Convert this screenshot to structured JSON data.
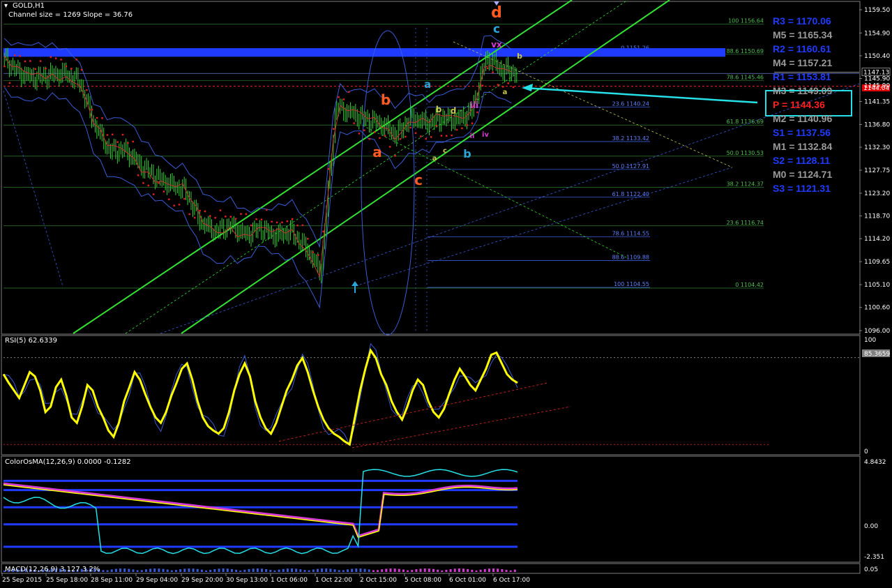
{
  "window": {
    "title": "GOLD,H1",
    "channel_info": "Channel size = 1269 Slope = 36.76"
  },
  "chart_data": [
    {
      "type": "line",
      "name": "price",
      "title": "GOLD,H1",
      "subtitle": "Channel size = 1269 Slope = 36.76",
      "ylim": [
        1096.0,
        1159.5
      ],
      "y_ticks": [
        "1159.50",
        "1154.90",
        "1150.40",
        "1145.90",
        "1141.35",
        "1136.80",
        "1132.30",
        "1127.75",
        "1123.20",
        "1118.70",
        "1114.20",
        "1109.65",
        "1105.10",
        "1100.60",
        "1096.00"
      ],
      "x": [
        "25 Sep 2015",
        "25 Sep 18:00",
        "28 Sep 11:00",
        "29 Sep 04:00",
        "29 Sep 20:00",
        "30 Sep 13:00",
        "1 Oct 06:00",
        "1 Oct 22:00",
        "2 Oct 15:00",
        "5 Oct 08:00",
        "6 Oct 01:00",
        "6 Oct 17:00"
      ],
      "close_path": [
        1149.8,
        1146.9,
        1146.0,
        1146.5,
        1146.9,
        1145.2,
        1136.5,
        1131.5,
        1131.8,
        1128.8,
        1126.6,
        1124.9,
        1123.8,
        1117.6,
        1115.5,
        1116.8,
        1114.9,
        1116.2,
        1114.7,
        1115.6,
        1112.4,
        1107.5,
        1140.2,
        1139.1,
        1137.8,
        1137.0,
        1134.7,
        1138.3,
        1137.1,
        1138.0,
        1137.8,
        1139.2,
        1150.2,
        1147.6,
        1147.1
      ],
      "current_price": "1147.13",
      "bid_label": "1144.04",
      "extra_ticks": [
        "1145.90"
      ],
      "fib_retrace_1": [
        {
          "level": "100 1156.64"
        },
        {
          "level": "88.6 1150.69"
        },
        {
          "level": "78.6 1145.46"
        },
        {
          "level": "61.8 1136.69"
        },
        {
          "level": "50.0 1130.53"
        },
        {
          "level": "38.2 1124.37"
        },
        {
          "level": "23.6 1116.74"
        },
        {
          "level": "0 1104.42"
        }
      ],
      "fib_retrace_2": [
        {
          "level": "0 1151.26"
        },
        {
          "level": "23.6 1140.24"
        },
        {
          "level": "38.2 1133.42"
        },
        {
          "level": "50.0 1127.91"
        },
        {
          "level": "61.8 1122.40"
        },
        {
          "level": "78.6 1114.55"
        },
        {
          "level": "88.6 1109.88"
        },
        {
          "level": "100 1104.55"
        }
      ],
      "pivots": [
        {
          "label": "R3 = 1170.06",
          "color": "#1f3bff"
        },
        {
          "label": "M5 = 1165.34",
          "color": "#9a9a9a"
        },
        {
          "label": "R2 = 1160.61",
          "color": "#1f3bff"
        },
        {
          "label": "M4 = 1157.21",
          "color": "#9a9a9a"
        },
        {
          "label": "R1 = 1153.81",
          "color": "#1f3bff"
        },
        {
          "label": "M3 = 1149.09",
          "color": "#9a9a9a"
        },
        {
          "label": "P  = 1144.36",
          "color": "#ff2020"
        },
        {
          "label": "M2 = 1140.96",
          "color": "#9a9a9a"
        },
        {
          "label": "S1 = 1137.56",
          "color": "#1f3bff"
        },
        {
          "label": "M1 = 1132.84",
          "color": "#9a9a9a"
        },
        {
          "label": "S2 = 1128.11",
          "color": "#1f3bff"
        },
        {
          "label": "M0 = 1124.71",
          "color": "#9a9a9a"
        },
        {
          "label": "S3 = 1121.31",
          "color": "#1f3bff"
        }
      ],
      "wave_labels": [
        {
          "text": "d",
          "color": "#ff5a1f"
        },
        {
          "text": "c",
          "color": "#2aa6d8"
        },
        {
          "text": "vx",
          "color": "#d63ad6"
        },
        {
          "text": "b",
          "color": "#ff5a1f"
        },
        {
          "text": "a",
          "color": "#2aa6d8"
        },
        {
          "text": "a",
          "color": "#ff5a1f"
        },
        {
          "text": "c",
          "color": "#ff5a1f"
        },
        {
          "text": "b",
          "color": "#2aa6d8"
        },
        {
          "text": "iii",
          "color": "#d63ad6"
        },
        {
          "text": "iv",
          "color": "#d63ad6"
        },
        {
          "text": "ii",
          "color": "#d63ad6"
        },
        {
          "text": "b",
          "color": "#c8c850"
        },
        {
          "text": "d",
          "color": "#c8c850"
        },
        {
          "text": "a",
          "color": "#c8c850"
        },
        {
          "text": "c",
          "color": "#c8c850"
        },
        {
          "text": "b",
          "color": "#c8c850"
        },
        {
          "text": "a",
          "color": "#c8c850"
        }
      ]
    },
    {
      "type": "line",
      "name": "rsi",
      "title": "RSI(5) 62.6339",
      "ylim": [
        0,
        100
      ],
      "y_ticks": [
        "100",
        "0"
      ],
      "level_label": "85.3659",
      "values": [
        70,
        62,
        55,
        48,
        60,
        72,
        68,
        55,
        35,
        40,
        58,
        65,
        50,
        30,
        25,
        40,
        60,
        55,
        40,
        30,
        18,
        12,
        25,
        45,
        58,
        72,
        65,
        52,
        40,
        30,
        25,
        35,
        50,
        62,
        75,
        80,
        65,
        45,
        30,
        22,
        18,
        15,
        20,
        35,
        55,
        70,
        80,
        68,
        45,
        30,
        20,
        15,
        25,
        40,
        55,
        65,
        78,
        85,
        72,
        55,
        40,
        28,
        20,
        15,
        12,
        8,
        5,
        30,
        55,
        75,
        92,
        85,
        70,
        60,
        45,
        35,
        28,
        40,
        55,
        65,
        60,
        45,
        35,
        30,
        38,
        52,
        65,
        75,
        68,
        60,
        55,
        65,
        75,
        88,
        90,
        80,
        70,
        65,
        62
      ]
    },
    {
      "type": "line",
      "name": "coloroma",
      "title": "ColorOsMA(12,26,9) 0.0000 -0.1282",
      "ylim": [
        -2.351,
        4.8432
      ],
      "y_ticks": [
        "4.8432",
        "0.00",
        "-2.351"
      ]
    },
    {
      "type": "bar",
      "name": "macd",
      "title": "MACD(12,26,9) 3.127 3.2%",
      "y_ticks": [
        "0.05"
      ]
    }
  ]
}
